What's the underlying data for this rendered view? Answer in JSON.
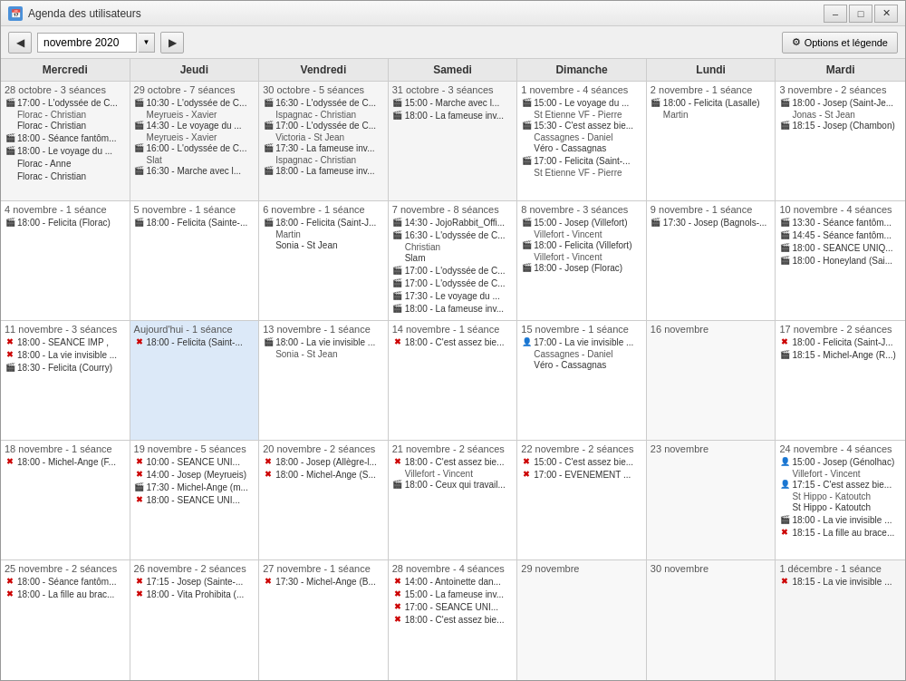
{
  "window": {
    "title": "Agenda des utilisateurs",
    "icon": "📅"
  },
  "toolbar": {
    "month": "novembre 2020",
    "options_label": "Options et légende"
  },
  "headers": [
    "Mercredi",
    "Jeudi",
    "Vendredi",
    "Samedi",
    "Dimanche",
    "Lundi",
    "Mardi"
  ],
  "weeks": [
    {
      "days": [
        {
          "label": "28 octobre - 3 séances",
          "other_month": true,
          "events": [
            {
              "icon": "film",
              "text": "17:00 - L'odyssée de C...",
              "sub": "Florac - Christian"
            },
            {
              "icon": "",
              "text": "Florac - Christian",
              "sub": ""
            },
            {
              "icon": "film",
              "text": "18:00 - Séance fantôm...",
              "sub": ""
            },
            {
              "icon": "film",
              "text": "18:00 - Le voyage du ...",
              "sub": ""
            },
            {
              "icon": "",
              "text": "Florac - Anne",
              "sub": ""
            },
            {
              "icon": "",
              "text": "Florac - Christian",
              "sub": ""
            }
          ]
        },
        {
          "label": "29 octobre - 7 séances",
          "other_month": true,
          "events": [
            {
              "icon": "film",
              "text": "10:30 - L'odyssée de C...",
              "sub": "Meyrueis - Xavier"
            },
            {
              "icon": "film",
              "text": "14:30 - Le voyage du ...",
              "sub": "Meyrueis - Xavier"
            },
            {
              "icon": "film",
              "text": "16:00 - L'odyssée de C...",
              "sub": "Slat"
            },
            {
              "icon": "film",
              "text": "16:30 - Marche avec l...",
              "sub": ""
            }
          ]
        },
        {
          "label": "30 octobre - 5 séances",
          "other_month": true,
          "events": [
            {
              "icon": "film",
              "text": "16:30 - L'odyssée de C...",
              "sub": "Ispagnac - Christian"
            },
            {
              "icon": "film",
              "text": "17:00 - L'odyssée de C...",
              "sub": "Victoria - St Jean"
            },
            {
              "icon": "film",
              "text": "17:30 - La fameuse inv...",
              "sub": "Ispagnac - Christian"
            },
            {
              "icon": "film",
              "text": "18:00 - La fameuse inv...",
              "sub": ""
            }
          ]
        },
        {
          "label": "31 octobre - 3 séances",
          "other_month": true,
          "events": [
            {
              "icon": "film",
              "text": "15:00 - Marche avec l...",
              "sub": ""
            },
            {
              "icon": "film",
              "text": "18:00 - La fameuse inv...",
              "sub": ""
            }
          ]
        },
        {
          "label": "1 novembre - 4 séances",
          "events": [
            {
              "icon": "film",
              "text": "15:00 - Le voyage du ...",
              "sub": "St Etienne VF - Pierre"
            },
            {
              "icon": "film",
              "text": "15:30 - C'est assez bie...",
              "sub": "Cassagnes - Daniel"
            },
            {
              "icon": "",
              "text": "Véro - Cassagnas",
              "sub": ""
            },
            {
              "icon": "film",
              "text": "17:00 - Felicita (Saint-...",
              "sub": "St Etienne VF - Pierre"
            }
          ]
        },
        {
          "label": "2 novembre - 1 séance",
          "events": [
            {
              "icon": "film",
              "text": "18:00 - Felicita (Lasalle)",
              "sub": "Martin"
            }
          ]
        },
        {
          "label": "3 novembre - 2 séances",
          "events": [
            {
              "icon": "film",
              "text": "18:00 - Josep (Saint-Je...",
              "sub": "Jonas - St Jean"
            },
            {
              "icon": "film",
              "text": "18:15 - Josep (Chambon)",
              "sub": ""
            }
          ]
        }
      ]
    },
    {
      "days": [
        {
          "label": "4 novembre - 1 séance",
          "events": [
            {
              "icon": "film",
              "text": "18:00 - Felicita (Florac)",
              "sub": ""
            }
          ]
        },
        {
          "label": "5 novembre - 1 séance",
          "events": [
            {
              "icon": "film",
              "text": "18:00 - Felicita (Sainte-...",
              "sub": ""
            }
          ]
        },
        {
          "label": "6 novembre - 1 séance",
          "events": [
            {
              "icon": "film",
              "text": "18:00 - Felicita (Saint-J...",
              "sub": "Martin"
            },
            {
              "icon": "",
              "text": "Sonia - St Jean",
              "sub": ""
            }
          ]
        },
        {
          "label": "7 novembre - 8 séances",
          "events": [
            {
              "icon": "film",
              "text": "14:30 - JojoRabbit_Offi...",
              "sub": ""
            },
            {
              "icon": "film",
              "text": "16:30 - L'odyssée de C...",
              "sub": "Christian"
            },
            {
              "icon": "",
              "text": "Slam",
              "sub": ""
            },
            {
              "icon": "film",
              "text": "17:00 - L'odyssée de C...",
              "sub": ""
            },
            {
              "icon": "film",
              "text": "17:00 - L'odyssée de C...",
              "sub": ""
            },
            {
              "icon": "film",
              "text": "17:30 - Le voyage du ...",
              "sub": ""
            },
            {
              "icon": "film",
              "text": "18:00 - La fameuse inv...",
              "sub": ""
            }
          ]
        },
        {
          "label": "8 novembre - 3 séances",
          "events": [
            {
              "icon": "film",
              "text": "15:00 - Josep (Villefort)",
              "sub": "Villefort - Vincent"
            },
            {
              "icon": "film",
              "text": "18:00 - Felicita (Villefort)",
              "sub": "Villefort - Vincent"
            },
            {
              "icon": "film",
              "text": "18:00 - Josep (Florac)",
              "sub": ""
            }
          ]
        },
        {
          "label": "9 novembre - 1 séance",
          "events": [
            {
              "icon": "film",
              "text": "17:30 - Josep (Bagnols-...",
              "sub": ""
            }
          ]
        },
        {
          "label": "10 novembre - 4 séances",
          "events": [
            {
              "icon": "film",
              "text": "13:30 - Séance fantôm...",
              "sub": ""
            },
            {
              "icon": "film",
              "text": "14:45 - Séance fantôm...",
              "sub": ""
            },
            {
              "icon": "film",
              "text": "18:00 - SEANCE UNIQ...",
              "sub": ""
            },
            {
              "icon": "film",
              "text": "18:00 - Honeyland (Sai...",
              "sub": ""
            }
          ]
        }
      ]
    },
    {
      "days": [
        {
          "label": "11 novembre - 3 séances",
          "events": [
            {
              "icon": "error",
              "text": "18:00 - SEANCE IMP ,",
              "sub": ""
            },
            {
              "icon": "error",
              "text": "18:00 - La vie invisible ...",
              "sub": ""
            },
            {
              "icon": "film",
              "text": "18:30 - Felicita (Courry)",
              "sub": ""
            }
          ]
        },
        {
          "label": "Aujourd'hui - 1 séance",
          "today": true,
          "events": [
            {
              "icon": "error",
              "text": "18:00 - Felicita (Saint-...",
              "sub": ""
            }
          ]
        },
        {
          "label": "13 novembre - 1 séance",
          "events": [
            {
              "icon": "film",
              "text": "18:00 - La vie invisible ...",
              "sub": "Sonia - St Jean"
            }
          ]
        },
        {
          "label": "14 novembre - 1 séance",
          "events": [
            {
              "icon": "error",
              "text": "18:00 - C'est assez bie...",
              "sub": ""
            }
          ]
        },
        {
          "label": "15 novembre - 1 séance",
          "events": [
            {
              "icon": "person",
              "text": "17:00 - La vie invisible ...",
              "sub": "Cassagnes - Daniel"
            },
            {
              "icon": "",
              "text": "Véro - Cassagnas",
              "sub": ""
            }
          ]
        },
        {
          "label": "16 novembre",
          "events": []
        },
        {
          "label": "17 novembre - 2 séances",
          "events": [
            {
              "icon": "error",
              "text": "18:00 - Felicita (Saint-J...",
              "sub": ""
            },
            {
              "icon": "film",
              "text": "18:15 - Michel-Ange (R...)",
              "sub": ""
            }
          ]
        }
      ]
    },
    {
      "days": [
        {
          "label": "18 novembre - 1 séance",
          "events": [
            {
              "icon": "error",
              "text": "18:00 - Michel-Ange (F...",
              "sub": ""
            }
          ]
        },
        {
          "label": "19 novembre - 5 séances",
          "events": [
            {
              "icon": "error",
              "text": "10:00 - SEANCE UNI...",
              "sub": ""
            },
            {
              "icon": "error",
              "text": "14:00 - Josep (Meyrueis)",
              "sub": ""
            },
            {
              "icon": "film",
              "text": "17:30 - Michel-Ange (m...",
              "sub": ""
            },
            {
              "icon": "error",
              "text": "18:00 - SEANCE UNI...",
              "sub": ""
            }
          ]
        },
        {
          "label": "20 novembre - 2 séances",
          "events": [
            {
              "icon": "error",
              "text": "18:00 - Josep (Allègre-l...",
              "sub": ""
            },
            {
              "icon": "error",
              "text": "18:00 - Michel-Ange (S...",
              "sub": ""
            }
          ]
        },
        {
          "label": "21 novembre - 2 séances",
          "events": [
            {
              "icon": "error",
              "text": "18:00 - C'est assez bie...",
              "sub": "Villefort - Vincent"
            },
            {
              "icon": "film",
              "text": "18:00 - Ceux qui travail...",
              "sub": ""
            }
          ]
        },
        {
          "label": "22 novembre - 2 séances",
          "events": [
            {
              "icon": "error",
              "text": "15:00 - C'est assez bie...",
              "sub": ""
            },
            {
              "icon": "error",
              "text": "17:00 - EVENEMENT ...",
              "sub": ""
            }
          ]
        },
        {
          "label": "23 novembre",
          "events": []
        },
        {
          "label": "24 novembre - 4 séances",
          "events": [
            {
              "icon": "person",
              "text": "15:00 - Josep (Génolhac)",
              "sub": "Villefort - Vincent"
            },
            {
              "icon": "person",
              "text": "17:15 - C'est assez bie...",
              "sub": "St Hippo - Katoutch"
            },
            {
              "icon": "",
              "text": "St Hippo - Katoutch",
              "sub": ""
            },
            {
              "icon": "film",
              "text": "18:00 - La vie invisible ...",
              "sub": ""
            },
            {
              "icon": "error",
              "text": "18:15 - La fille au brace...",
              "sub": ""
            }
          ]
        }
      ]
    },
    {
      "days": [
        {
          "label": "25 novembre - 2 séances",
          "events": [
            {
              "icon": "error",
              "text": "18:00 - Séance fantôm...",
              "sub": ""
            },
            {
              "icon": "error",
              "text": "18:00 - La fille au brac...",
              "sub": ""
            }
          ]
        },
        {
          "label": "26 novembre - 2 séances",
          "events": [
            {
              "icon": "error",
              "text": "17:15 - Josep (Sainte-...",
              "sub": ""
            },
            {
              "icon": "error",
              "text": "18:00 - Vita Prohibita (...",
              "sub": ""
            }
          ]
        },
        {
          "label": "27 novembre - 1 séance",
          "events": [
            {
              "icon": "error",
              "text": "17:30 - Michel-Ange (B...",
              "sub": ""
            }
          ]
        },
        {
          "label": "28 novembre - 4 séances",
          "events": [
            {
              "icon": "error",
              "text": "14:00 - Antoinette dan...",
              "sub": ""
            },
            {
              "icon": "error",
              "text": "15:00 - La fameuse inv...",
              "sub": ""
            },
            {
              "icon": "error",
              "text": "17:00 - SEANCE UNI...",
              "sub": ""
            },
            {
              "icon": "error",
              "text": "18:00 - C'est assez bie...",
              "sub": ""
            }
          ]
        },
        {
          "label": "29 novembre",
          "events": []
        },
        {
          "label": "30 novembre",
          "events": []
        },
        {
          "label": "1 décembre - 1 séance",
          "other_month": true,
          "events": [
            {
              "icon": "error",
              "text": "18:15 - La vie invisible ...",
              "sub": ""
            }
          ]
        }
      ]
    }
  ]
}
